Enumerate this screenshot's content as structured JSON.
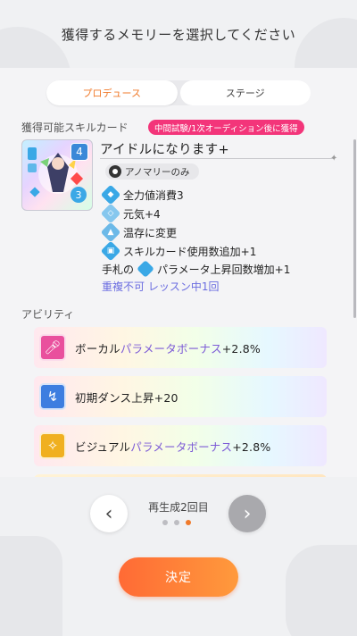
{
  "header": {
    "title": "獲得するメモリーを選択してください"
  },
  "tabs": [
    {
      "label": "プロデュース",
      "active": true
    },
    {
      "label": "ステージ",
      "active": false
    }
  ],
  "skill": {
    "section_label": "獲得可能スキルカード",
    "condition_badge": "中間試験/1次オーディション後に獲得",
    "card_cost": "4",
    "card_level": "3",
    "name": "アイドルになります+",
    "anomaly_tag": "アノマリーのみ",
    "effects": [
      {
        "icon": "diamond-icon",
        "text": "全力値消費3"
      },
      {
        "icon": "shield-icon",
        "text": "元気+4"
      },
      {
        "icon": "flame-icon",
        "text": "温存に変更"
      },
      {
        "icon": "card-icon",
        "text": "スキルカード使用数追加+1"
      }
    ],
    "hand_line": {
      "prefix": "手札の",
      "text": "パラメータ上昇回数増加+1"
    },
    "note": "重複不可 レッスン中1回"
  },
  "abilities": {
    "section_label": "アビリティ",
    "items": [
      {
        "icon": "microphone-icon",
        "color": "#e9509d",
        "label": "ボーカル",
        "highlight": "パラメータボーナス",
        "suffix": "+2.8%"
      },
      {
        "icon": "dance-icon",
        "color": "#3d7ee0",
        "label": "初期ダンス上昇+20",
        "highlight": "",
        "suffix": ""
      },
      {
        "icon": "visual-icon",
        "color": "#f0b020",
        "label": "ビジュアル",
        "highlight": "パラメータボーナス",
        "suffix": "+2.8%"
      }
    ]
  },
  "nav": {
    "regen_label": "再生成2回目",
    "page_count": 3,
    "active_page": 3
  },
  "confirm": {
    "label": "決定"
  },
  "colors": {
    "accent": "#f07a2a",
    "badge_pink": "#f3357a",
    "note_purple": "#6a6ce0"
  }
}
